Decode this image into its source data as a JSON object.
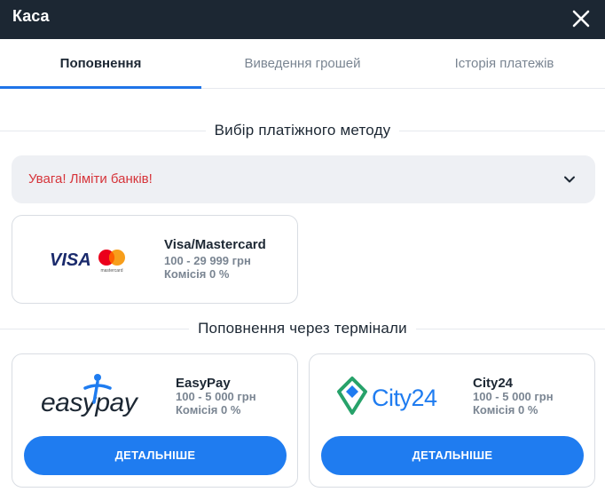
{
  "header": {
    "title": "Каса",
    "close_icon": "close-icon"
  },
  "tabs": [
    {
      "label": "Поповнення",
      "active": true
    },
    {
      "label": "Виведення грошей",
      "active": false
    },
    {
      "label": "Історія платежів",
      "active": false
    }
  ],
  "payment_section": {
    "title": "Вибір платіжного методу",
    "warning": {
      "text": "Увага! Ліміти банків!",
      "icon": "chevron-down-icon"
    },
    "methods": [
      {
        "name": "Visa/Mastercard",
        "range": "100 - 29 999 грн",
        "fee": "Комісія 0 %",
        "logo_text": "VISA",
        "logo_sub": "mastercard"
      }
    ]
  },
  "terminals_section": {
    "title": "Поповнення через термінали",
    "methods": [
      {
        "name": "EasyPay",
        "range": "100 - 5 000 грн",
        "fee": "Комісія 0 %",
        "logo_text": "easypay",
        "button": "ДЕТАЛЬНІШЕ"
      },
      {
        "name": "City24",
        "range": "100 - 5 000 грн",
        "fee": "Комісія 0 %",
        "logo_text": "City24",
        "button": "ДЕТАЛЬНІШЕ"
      }
    ]
  },
  "colors": {
    "header_bg": "#1c2733",
    "accent": "#1f7cf0",
    "warning_text": "#d6343a"
  }
}
